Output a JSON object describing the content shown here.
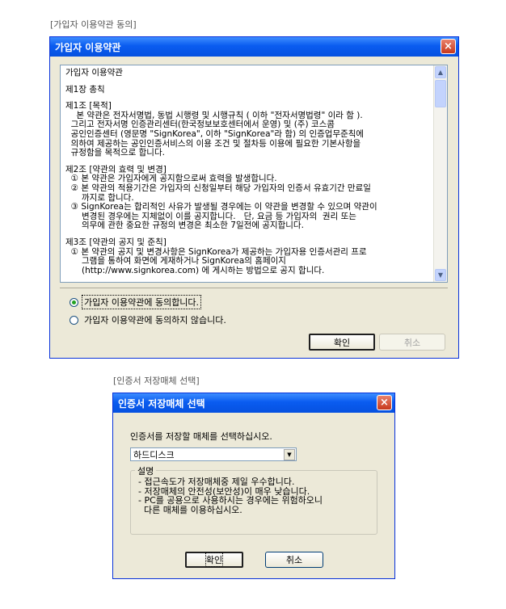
{
  "section1_caption": "[가입자 이용약관 동의]",
  "terms_dialog": {
    "title": "가입자 이용약관",
    "close_glyph": "×",
    "terms_lines": [
      "가입자 이용약관",
      "",
      "제1장 총칙",
      "",
      "제1조 [목적]",
      "    본 약관은 전자서명법, 동법 시행령 및 시행규칙 ( 이하 \"전자서명법령\" 이라 함 ).",
      "  그리고 전자서명 인증관리센터(한국정보보호센터에서 운영) 및 (주) 코스콤",
      "  공인인증센터 (영문명 \"SignKorea\", 이하 \"SignKorea\"라 함) 의 인증업무준칙에",
      "  의하여 제공하는 공인인증서비스의 이용 조건 및 절차등 이용에 필요한 기본사항을",
      "  규정함을 목적으로 합니다.",
      "",
      "제2조 [약관의 효력 및 변경]",
      "  ① 본 약관은 가입자에게 공지함으로써 효력을 발생합니다.",
      "  ② 본 약관의 적용기간은 가입자의 신청일부터 해당 가입자의 인증서 유효기간 만료일",
      "      까지로 합니다.",
      "  ③ SignKorea는 합리적인 사유가 발생될 경우에는 이 약관을 변경할 수 있으며 약관이",
      "      변경된 경우에는 지체없이 이를 공지합니다.   단, 요금 등 가입자의  권리 또는",
      "      의무에 관한 중요한 규정의 변경은 최소한 7일전에 공지합니다.",
      "",
      "제3조 [약관의 공지 및 준칙]",
      "  ① 본 약관의 공지 및 변경사항은 SignKorea가 제공하는 가입자용 인증서관리 프로",
      "      그램을 통하여 화면에 게재하거나 SignKorea의 홈페이지",
      "      (http://www.signkorea.com) 에 게시하는 방법으로 공지 합니다."
    ],
    "radio_agree": "가입자 이용약관에 동의합니다.",
    "radio_disagree": "가입자 이용약관에 동의하지 않습니다.",
    "selected": "agree",
    "ok_label": "확인",
    "cancel_label": "취소"
  },
  "section2_caption": "[인증서 저장매체 선택]",
  "storage_dialog": {
    "title": "인증서 저장매체 선택",
    "close_glyph": "×",
    "prompt": "인증서를 저장할 매체를 선택하십시오.",
    "selected_media": "하드디스크",
    "group_title": "설명",
    "desc_lines": [
      "- 접근속도가 저장매체중 제일 우수합니다.",
      "- 저장매체의 안전성(보안성)이 매우 낮습니다.",
      "- PC를 공용으로 사용하시는 경우에는 위험하오니",
      "  다른 매체를 이용하십시오."
    ],
    "ok_label": "확인",
    "cancel_label": "취소"
  },
  "icons": {
    "scroll_up": "▲",
    "scroll_down": "▼",
    "dropdown": "▼"
  },
  "colors": {
    "titlebar": "#0a5cf0",
    "dialog_bg": "#ece9d8",
    "close_button": "#c7381c"
  }
}
